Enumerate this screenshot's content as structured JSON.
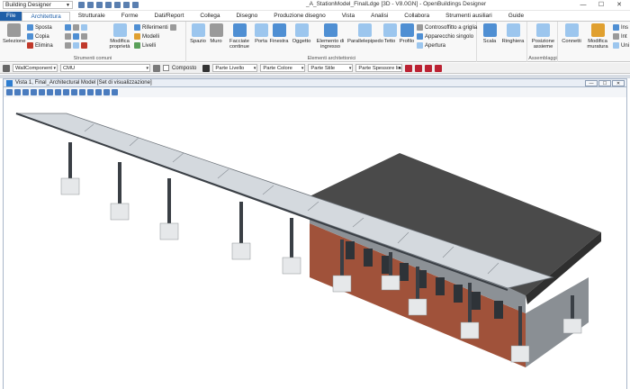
{
  "titlebar": {
    "workspace": "Building Designer",
    "app_title": "_A_StationModel_FinalLdge [3D - V8.0GN] - OpenBuildings Designer",
    "min": "—",
    "max": "☐",
    "close": "✕"
  },
  "tabs": [
    "File",
    "Architettura",
    "Strutturale",
    "Forme",
    "Dati/Report",
    "Collega",
    "Disegno",
    "Produzione disegno",
    "Vista",
    "Analisi",
    "Collabora",
    "Strumenti ausiliari",
    "Guide"
  ],
  "ribbon": {
    "groups": {
      "comuni": "Strumenti comuni",
      "arch": "Elementi architettonici",
      "assembl": "Assemblaggi"
    },
    "buttons": {
      "selezione": "Selezione",
      "sposta": "Sposta",
      "copia": "Copia",
      "elimina": "Elimina",
      "modifica_prop": "Modifica proprietà",
      "riferimenti": "Riferimenti",
      "modelli": "Modelli",
      "livelli": "Livelli",
      "spazio": "Spazio",
      "muro": "Muro",
      "facciate": "Facciate continue",
      "porta": "Porta",
      "finestra": "Finestra",
      "oggetto": "Oggetto",
      "elemento_ingresso": "Elemento di ingresso",
      "parallelepipedo": "Parallelepipedo",
      "tetto": "Tetto",
      "profilo": "Profilo",
      "controsoffitto": "Controsoffitto a griglia",
      "apparecchio": "Apparecchio singolo",
      "apertura": "Apertura",
      "scala": "Scala",
      "ringhiera": "Ringhiera",
      "posizione_assieme": "Posizione assieme",
      "connetti": "Connetti",
      "modifica_muratura": "Modifica muratura",
      "ins": "Ins",
      "ints": "Int",
      "uni": "Uni"
    }
  },
  "attrbar": {
    "component": "WallComponent",
    "material": "CMU",
    "composto": "Composto",
    "livello": "Parte Livello",
    "colore": "Parte Colore",
    "stile": "Parte Stile",
    "spessore": "Parte Spessore lin"
  },
  "view": {
    "title": "Vista 1, Final_Architectural Model [Set di visualizzazione]"
  },
  "colors": {
    "accent": "#1f5fa8",
    "roof_dark": "#4a4a4a",
    "brick": "#a0523a",
    "glass": "#d4d9de",
    "steel": "#3a3f45"
  }
}
